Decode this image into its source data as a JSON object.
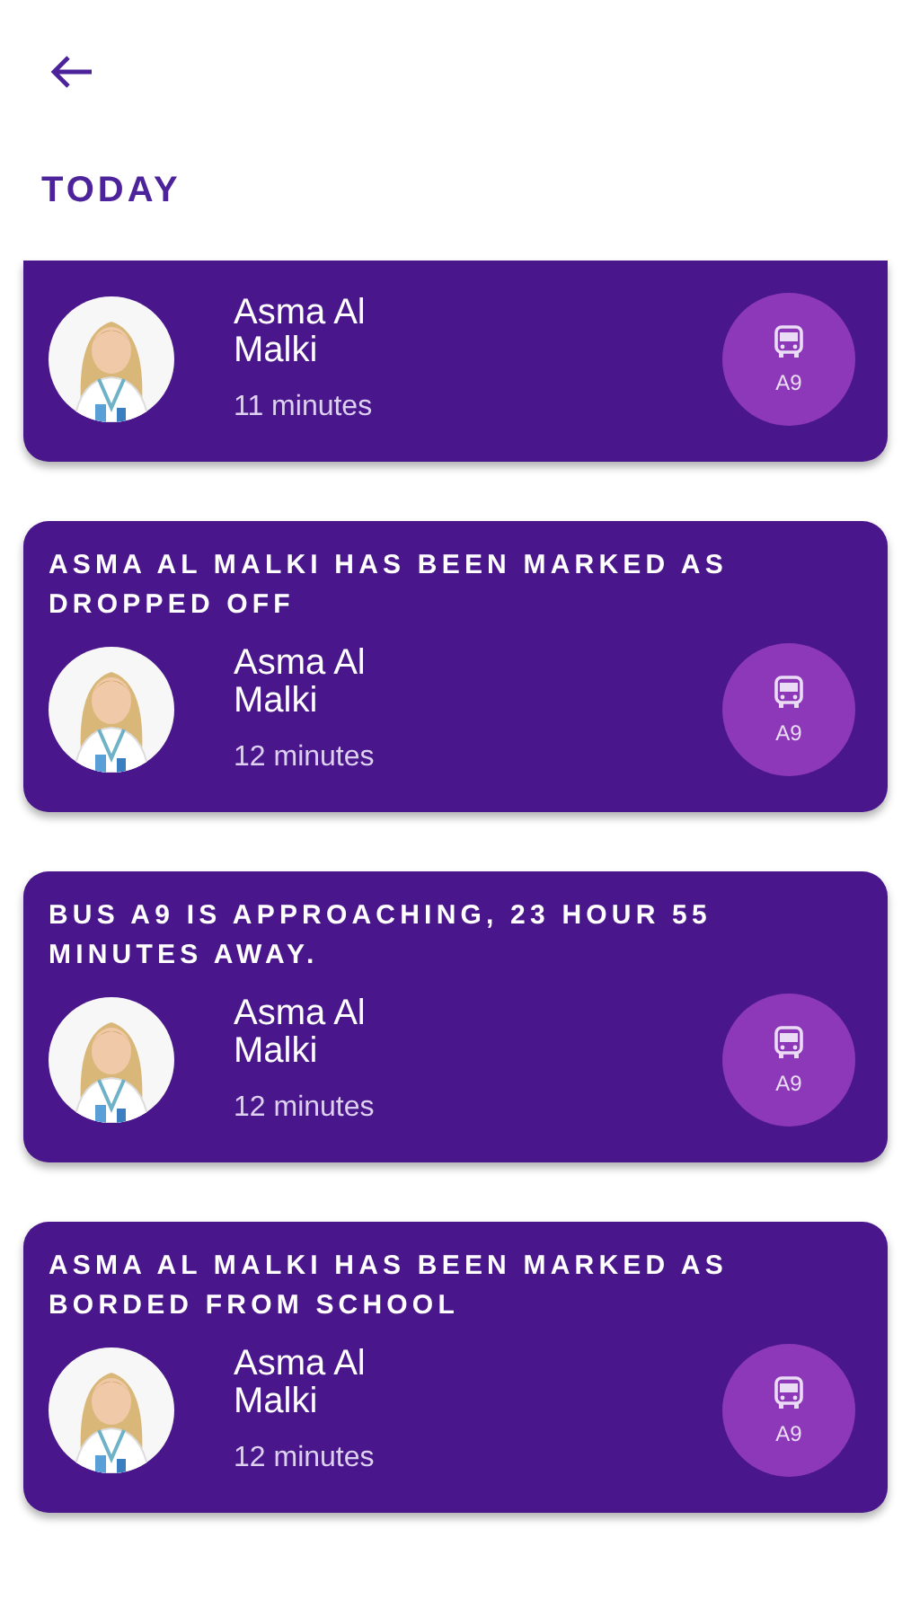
{
  "header": {
    "section_title": "TODAY"
  },
  "notifications": [
    {
      "name": "Asma Al Malki",
      "time": "11 minutes",
      "bus": "A9"
    },
    {
      "title": "ASMA AL MALKI HAS BEEN MARKED AS DROPPED OFF",
      "name": "Asma Al Malki",
      "time": "12 minutes",
      "bus": "A9"
    },
    {
      "title": "BUS A9 IS APPROACHING, 23 HOUR 55 MINUTES AWAY.",
      "name": "Asma Al Malki",
      "time": "12 minutes",
      "bus": "A9"
    },
    {
      "title": "ASMA AL MALKI HAS BEEN MARKED AS BORDED FROM SCHOOL",
      "name": "Asma Al Malki",
      "time": "12 minutes",
      "bus": "A9"
    }
  ]
}
